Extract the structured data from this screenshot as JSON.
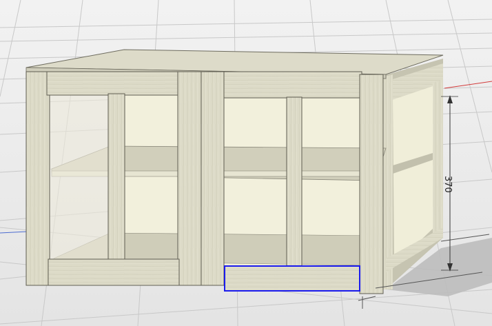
{
  "viewport": {
    "background": "#ebebeb",
    "grid_color": "#c9c9c9",
    "selection_color": "#1a1aee",
    "dimension": {
      "value_text": "370",
      "axis": "height"
    }
  },
  "model": {
    "type": "cabinet",
    "finish_color": "#d9d7c4",
    "panel_color": "#f1efdc",
    "shelf_color": "#d3d0bd",
    "selected_part": "front-bottom-rail-right"
  }
}
